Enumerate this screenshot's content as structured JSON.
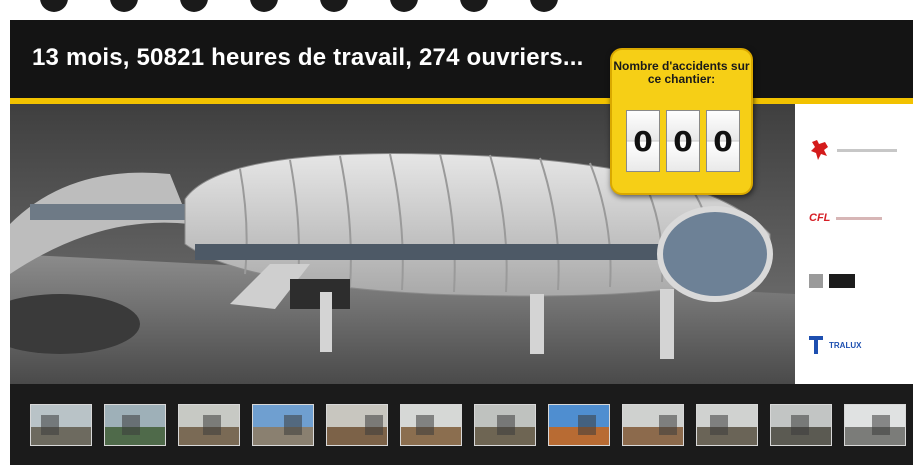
{
  "headline": "13 mois, 50821 heures de travail, 274 ouvriers...",
  "counter": {
    "title": "Nombre d'accidents sur ce chantier:",
    "digits": [
      "0",
      "0",
      "0"
    ]
  },
  "colors": {
    "accent": "#f2c200",
    "board": "#141414",
    "counter_panel": "#f6cf16"
  },
  "logos": [
    {
      "name": "lion-coat-of-arms-logo",
      "icon": "red-lion-icon"
    },
    {
      "name": "cfl-logo",
      "label": "CFL",
      "icon": "cfl-wordmark"
    },
    {
      "name": "dark-box-logo",
      "icon": "dark-rectangle-icon"
    },
    {
      "name": "tralux-logo",
      "label": "TRALUX",
      "icon": "blue-t-icon"
    }
  ],
  "photos": [
    {
      "id": "photo-1",
      "sky": "#b9c3c7",
      "ground": "#6d6a5f"
    },
    {
      "id": "photo-2",
      "sky": "#9eb0b8",
      "ground": "#4f6a4a"
    },
    {
      "id": "photo-3",
      "sky": "#c7c9c4",
      "ground": "#7a6a55"
    },
    {
      "id": "photo-4",
      "sky": "#6f9fd0",
      "ground": "#8a8070"
    },
    {
      "id": "photo-5",
      "sky": "#c8c6bf",
      "ground": "#7c6248"
    },
    {
      "id": "photo-6",
      "sky": "#d6d8d6",
      "ground": "#8b6e4f"
    },
    {
      "id": "photo-7",
      "sky": "#bfc2bf",
      "ground": "#6e6553"
    },
    {
      "id": "photo-8",
      "sky": "#4f8ed0",
      "ground": "#b86b33"
    },
    {
      "id": "photo-9",
      "sky": "#cfd1cf",
      "ground": "#8c6a4c"
    },
    {
      "id": "photo-10",
      "sky": "#d0d2d0",
      "ground": "#6a6457"
    },
    {
      "id": "photo-11",
      "sky": "#c2c5c4",
      "ground": "#5b5a52"
    },
    {
      "id": "photo-12",
      "sky": "#e0e2e2",
      "ground": "#7b7c79"
    }
  ]
}
